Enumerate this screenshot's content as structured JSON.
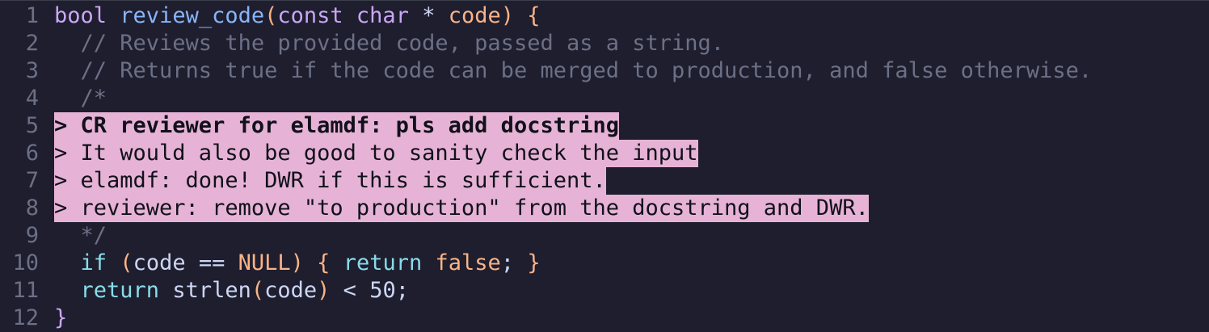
{
  "editor": {
    "colors": {
      "background": "#1e1e2e",
      "highlight": "#e6b3d6",
      "keyword": "#cba6f7",
      "function": "#89b4fa",
      "comment": "#6c7086",
      "control": "#89dceb",
      "constant": "#fab387"
    },
    "lines": [
      {
        "number": "1",
        "tokens": [
          {
            "text": "bool",
            "type": "keyword"
          },
          {
            "text": " ",
            "type": "plain"
          },
          {
            "text": "review_code",
            "type": "fn"
          },
          {
            "text": "(",
            "type": "paren"
          },
          {
            "text": "const",
            "type": "keyword"
          },
          {
            "text": " ",
            "type": "plain"
          },
          {
            "text": "char",
            "type": "keyword"
          },
          {
            "text": " * ",
            "type": "op"
          },
          {
            "text": "code",
            "type": "paren"
          },
          {
            "text": ") ",
            "type": "paren"
          },
          {
            "text": "{",
            "type": "brace"
          }
        ]
      },
      {
        "number": "2",
        "tokens": [
          {
            "text": "  // Reviews the provided code, passed as a string.",
            "type": "comment"
          }
        ]
      },
      {
        "number": "3",
        "tokens": [
          {
            "text": "  // Returns true if the code can be merged to production, and false otherwise.",
            "type": "comment"
          }
        ]
      },
      {
        "number": "4",
        "tokens": [
          {
            "text": "  /*",
            "type": "comment"
          }
        ]
      },
      {
        "number": "5",
        "highlight": true,
        "bold": true,
        "text": "> CR reviewer for elamdf: pls add docstring"
      },
      {
        "number": "6",
        "highlight": true,
        "text": "> It would also be good to sanity check the input"
      },
      {
        "number": "7",
        "highlight": true,
        "text": "> elamdf: done! DWR if this is sufficient."
      },
      {
        "number": "8",
        "highlight": true,
        "text": "> reviewer: remove \"to production\" from the docstring and DWR."
      },
      {
        "number": "9",
        "tokens": [
          {
            "text": "  */",
            "type": "comment"
          }
        ]
      },
      {
        "number": "10",
        "tokens": [
          {
            "text": "  ",
            "type": "plain"
          },
          {
            "text": "if",
            "type": "control"
          },
          {
            "text": " ",
            "type": "plain"
          },
          {
            "text": "(",
            "type": "paren"
          },
          {
            "text": "code == ",
            "type": "plain"
          },
          {
            "text": "NULL",
            "type": "const"
          },
          {
            "text": ")",
            "type": "paren"
          },
          {
            "text": " ",
            "type": "plain"
          },
          {
            "text": "{",
            "type": "brace"
          },
          {
            "text": " ",
            "type": "plain"
          },
          {
            "text": "return",
            "type": "control"
          },
          {
            "text": " ",
            "type": "plain"
          },
          {
            "text": "false",
            "type": "const"
          },
          {
            "text": "; ",
            "type": "plain"
          },
          {
            "text": "}",
            "type": "brace"
          }
        ]
      },
      {
        "number": "11",
        "tokens": [
          {
            "text": "  ",
            "type": "plain"
          },
          {
            "text": "return",
            "type": "control"
          },
          {
            "text": " strlen",
            "type": "plain"
          },
          {
            "text": "(",
            "type": "paren"
          },
          {
            "text": "code",
            "type": "plain"
          },
          {
            "text": ")",
            "type": "paren"
          },
          {
            "text": " < 50;",
            "type": "plain"
          }
        ]
      },
      {
        "number": "12",
        "tokens": [
          {
            "text": "}",
            "type": "keyword"
          }
        ]
      }
    ]
  }
}
